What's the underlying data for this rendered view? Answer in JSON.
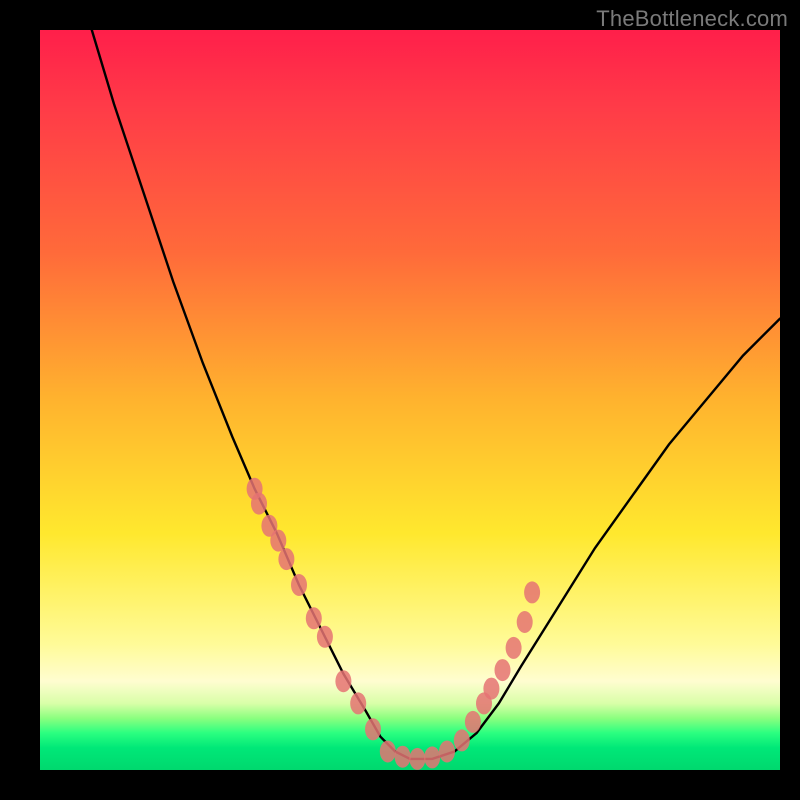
{
  "watermark": "TheBottleneck.com",
  "chart_data": {
    "type": "line",
    "title": "",
    "xlabel": "",
    "ylabel": "",
    "xlim": [
      0,
      100
    ],
    "ylim": [
      0,
      100
    ],
    "grid": false,
    "legend": false,
    "series": [
      {
        "name": "bottleneck-curve",
        "color": "#000000",
        "x": [
          7,
          10,
          14,
          18,
          22,
          26,
          29,
          32,
          35,
          38,
          41,
          44,
          46,
          48,
          50,
          53,
          56,
          59,
          62,
          65,
          70,
          75,
          80,
          85,
          90,
          95,
          100
        ],
        "y": [
          100,
          90,
          78,
          66,
          55,
          45,
          38,
          32,
          25,
          19,
          13,
          8,
          4.5,
          2.5,
          1.5,
          1.5,
          2.5,
          5,
          9,
          14,
          22,
          30,
          37,
          44,
          50,
          56,
          61
        ]
      }
    ],
    "markers": [
      {
        "name": "highlight-points-left",
        "color": "#e57373",
        "x": [
          29,
          29.6,
          31,
          32.2,
          33.3,
          35,
          37,
          38.5,
          41,
          43,
          45
        ],
        "y": [
          38,
          36,
          33,
          31,
          28.5,
          25,
          20.5,
          18,
          12,
          9,
          5.5
        ]
      },
      {
        "name": "highlight-points-bottom",
        "color": "#e57373",
        "x": [
          47,
          49,
          51,
          53,
          55
        ],
        "y": [
          2.5,
          1.8,
          1.5,
          1.7,
          2.5
        ]
      },
      {
        "name": "highlight-points-right",
        "color": "#e57373",
        "x": [
          57,
          58.5,
          60,
          61,
          62.5,
          64,
          65.5,
          66.5
        ],
        "y": [
          4,
          6.5,
          9,
          11,
          13.5,
          16.5,
          20,
          24
        ]
      }
    ],
    "background_gradient": {
      "direction": "vertical",
      "stops": [
        {
          "pos": 0.0,
          "color": "#ff1f4a"
        },
        {
          "pos": 0.3,
          "color": "#ff6a3a"
        },
        {
          "pos": 0.5,
          "color": "#ffb32e"
        },
        {
          "pos": 0.68,
          "color": "#ffe82e"
        },
        {
          "pos": 0.88,
          "color": "#fffdd0"
        },
        {
          "pos": 0.95,
          "color": "#2bff80"
        },
        {
          "pos": 1.0,
          "color": "#00d86e"
        }
      ]
    }
  }
}
